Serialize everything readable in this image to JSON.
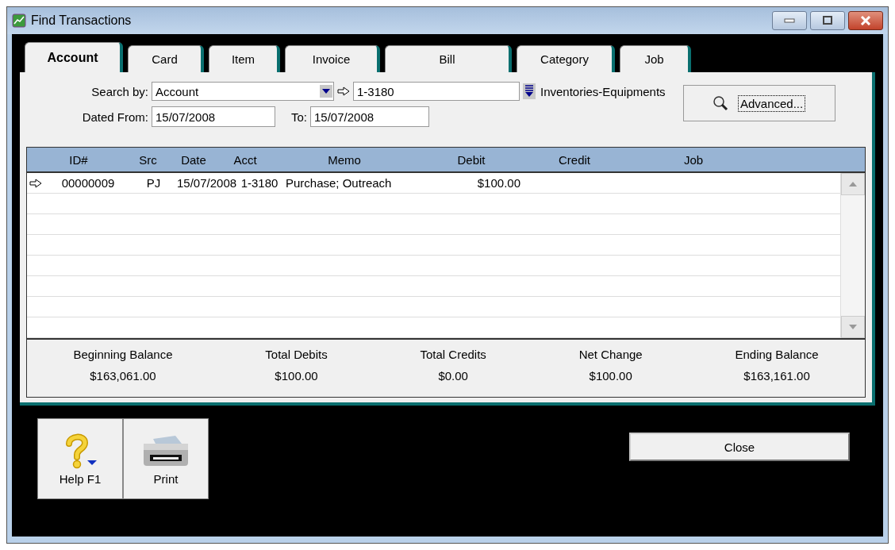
{
  "window": {
    "title": "Find Transactions"
  },
  "tabs": [
    {
      "label": "Account",
      "selected": true
    },
    {
      "label": "Card",
      "selected": false
    },
    {
      "label": "Item",
      "selected": false
    },
    {
      "label": "Invoice",
      "selected": false
    },
    {
      "label": "Bill",
      "selected": false
    },
    {
      "label": "Category",
      "selected": false
    },
    {
      "label": "Job",
      "selected": false
    }
  ],
  "filters": {
    "search_by_label": "Search by:",
    "search_by": "Account",
    "account_number": "1-3180",
    "account_name": "Inventories-Equipments",
    "dated_from_label": "Dated From:",
    "dated_from": "15/07/2008",
    "to_label": "To:",
    "to": "15/07/2008",
    "advanced_button": "Advanced..."
  },
  "table": {
    "columns": [
      "ID#",
      "Src",
      "Date",
      "Acct",
      "Memo",
      "Debit",
      "Credit",
      "Job"
    ],
    "rows": [
      {
        "current": true,
        "cells": [
          "00000009",
          "PJ",
          "15/07/2008",
          "1-3180",
          "Purchase; Outreach",
          "$100.00",
          "",
          ""
        ]
      }
    ]
  },
  "totals": [
    {
      "label": "Beginning Balance",
      "value": "$163,061.00"
    },
    {
      "label": "Total Debits",
      "value": "$100.00"
    },
    {
      "label": "Total Credits",
      "value": "$0.00"
    },
    {
      "label": "Net Change",
      "value": "$100.00"
    },
    {
      "label": "Ending Balance",
      "value": "$163,161.00"
    }
  ],
  "buttons": {
    "help": "Help F1",
    "print": "Print",
    "close": "Close"
  }
}
